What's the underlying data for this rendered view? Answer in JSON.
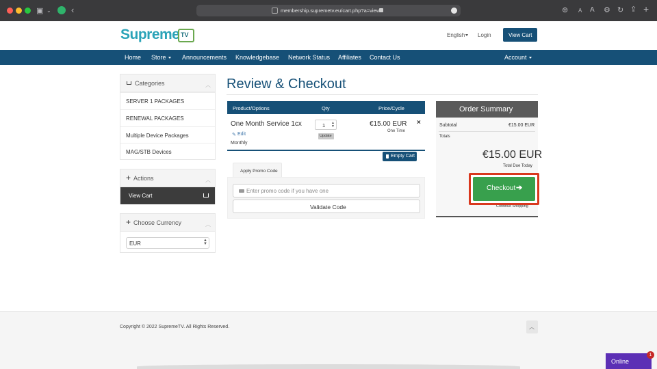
{
  "browser": {
    "url": "membership.supremetv.eu/cart.php?a=view",
    "lights": [
      "#fe5f57",
      "#febc2e",
      "#28c840"
    ]
  },
  "site": {
    "logo_text": "Supreme",
    "logo_badge": "TV",
    "lang_label": "English",
    "login_label": "Login",
    "view_cart_label": "View Cart"
  },
  "nav": {
    "home": "Home",
    "store": "Store",
    "announcements": "Announcements",
    "knowledgebase": "Knowledgebase",
    "network_status": "Network Status",
    "affiliates": "Affiliates",
    "contact_us": "Contact Us",
    "account": "Account"
  },
  "sidebar": {
    "categories_title": "Categories",
    "categories": [
      "SERVER 1 PACKAGES",
      "RENEWAL PACKAGES",
      "Multiple Device Packages",
      "MAG/STB Devices"
    ],
    "actions_title": "Actions",
    "view_cart": "View Cart",
    "currency_title": "Choose Currency",
    "currency_selected": "EUR"
  },
  "page": {
    "title": "Review & Checkout"
  },
  "cart": {
    "col_product": "Product/Options",
    "col_qty": "Qty",
    "col_price": "Price/Cycle",
    "item": {
      "name": "One Month Service 1cx",
      "edit": "Edit",
      "cycle": "Monthly",
      "qty": "1",
      "update": "Update",
      "price": "€15.00 EUR",
      "billing": "One Time",
      "remove": "×"
    },
    "empty_cart": "Empty Cart"
  },
  "promo": {
    "tab": "Apply Promo Code",
    "placeholder": "Enter promo code if you have one",
    "validate": "Validate Code"
  },
  "summary": {
    "title": "Order Summary",
    "subtotal_label": "Subtotal",
    "subtotal_value": "€15.00 EUR",
    "totals_label": "Totals",
    "total": "€15.00 EUR",
    "total_caption": "Total Due Today",
    "checkout": "Checkout",
    "continue": "Continue Shopping"
  },
  "footer": {
    "copyright": "Copyright © 2022 SupremeTV. All Rights Reserved."
  },
  "chat": {
    "label": "Online",
    "badge": "1"
  }
}
